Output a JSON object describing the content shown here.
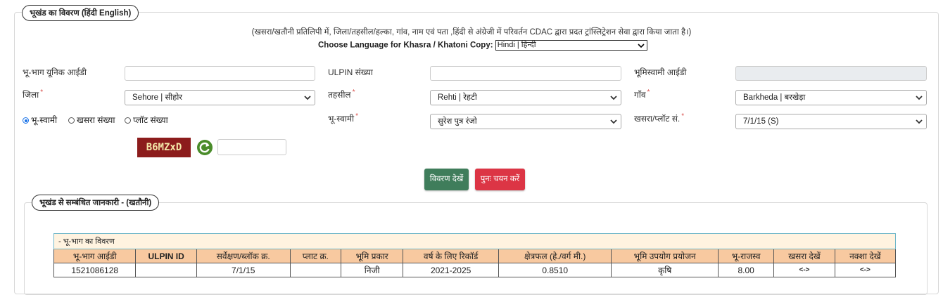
{
  "section1": {
    "legend": "भूखंड का विवरण  (हिंदी  English)",
    "note": "(खसरा/खतौनी प्रतिलिपी में, जिला/तहसील/हल्का, गांव, नाम एवं पता ,हिंदी से अंग्रेजी में परिवर्तन CDAC द्वारा प्रदत ट्रांस्लिट्रेशन सेवा द्वारा किया जाता है।)",
    "language_label": "Choose Language for Khasra / Khatoni Copy:",
    "language_value": "Hindi | हिन्दी"
  },
  "form": {
    "unique_id_label": "भू-भाग यूनिक आईडी",
    "unique_id_value": "",
    "ulpin_label": "ULPIN संख्या",
    "ulpin_value": "",
    "owner_id_label": "भूमिस्वामी आईडी",
    "district_label": "जिला",
    "district_value": "Sehore | सीहोर",
    "tehsil_label": "तहसील",
    "tehsil_value": "Rehti | रेहटी",
    "village_label": "गाँव",
    "village_value": "Barkheda | बरखेड़ा",
    "radio_owner": "भू-स्वामी",
    "radio_khasra": "खसरा संख्या",
    "radio_plot": "प्लॉट संख्या",
    "owner_label": "भू-स्वामी",
    "owner_value": "सुरेश पुत्र रंजो",
    "khasra_plot_label": "खसरा/प्लॉट सं.",
    "khasra_plot_value": "7/1/15 (S)",
    "required_mark": "*",
    "captcha_text": "B6MZxD",
    "captcha_input": ""
  },
  "buttons": {
    "view": "विवरण देखें",
    "reset": "पुनः चयन करें"
  },
  "section2": {
    "legend": "भूखंड से सम्बंधित जानकारी -   (खतौनी)"
  },
  "table": {
    "caption": "- भू-भाग का विवरण",
    "headers": [
      "भू-भाग आईडी",
      "ULPIN ID",
      "सर्वेक्षण/ब्लॉक क्र.",
      "प्लाट क्र.",
      "भूमि प्रकार",
      "वर्ष के लिए रिकॉर्ड",
      "क्षेत्रफल (हे./वर्ग मी.)",
      "भूमि उपयोग प्रयोजन",
      "भू-राजस्व",
      "खसरा देखें",
      "नक्शा देखें"
    ],
    "row": {
      "land_id": "1521086128",
      "ulpin": "",
      "survey": "7/1/15",
      "plot": "",
      "land_type": "निजी",
      "year": "2021-2025",
      "area": "0.8510",
      "use": "कृषि",
      "revenue": "8.00",
      "khasra_link": "<->",
      "map_link": "<->"
    }
  },
  "colors": {
    "view_button": "#3f7d5b",
    "reset_button": "#dc3545",
    "table_header": "#f8c9a0",
    "captcha_bg": "#8c1c1c"
  }
}
